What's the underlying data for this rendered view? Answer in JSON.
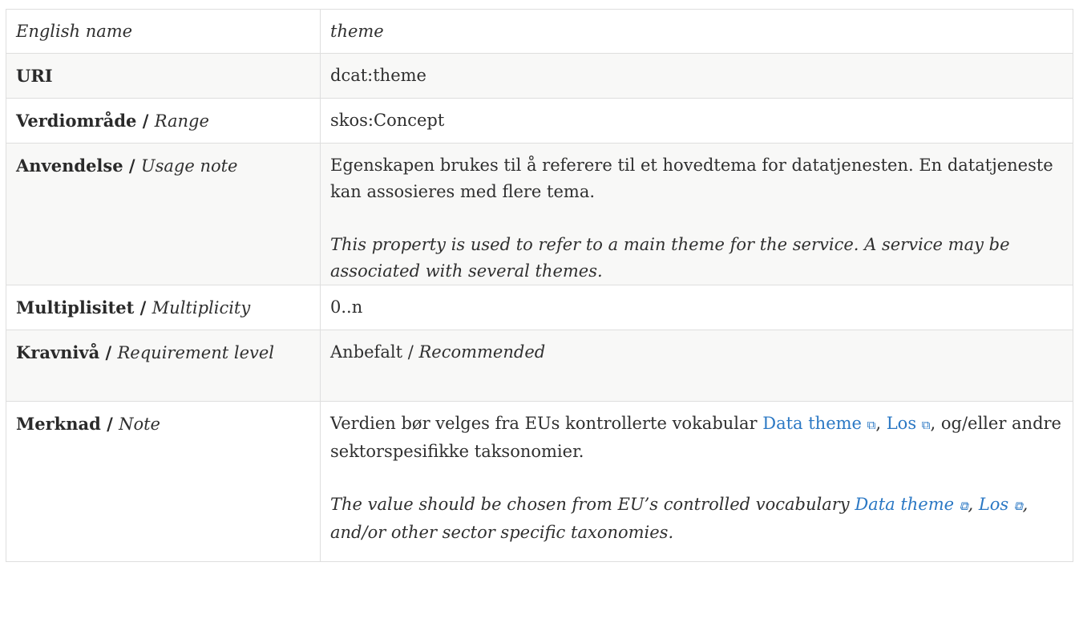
{
  "rows": {
    "english_name": {
      "label": "English name",
      "value": "theme"
    },
    "uri": {
      "label": "URI",
      "value": "dcat:theme"
    },
    "range": {
      "label_no": "Verdiområde",
      "sep": " / ",
      "label_en": "Range",
      "value": "skos:Concept"
    },
    "usage": {
      "label_no": "Anvendelse",
      "sep": " / ",
      "label_en": "Usage note",
      "value_no": "Egenskapen brukes til å referere til et hovedtema for datatjenesten. En datatjeneste kan assosieres med flere tema.",
      "value_en": "This property is used to refer to a main theme for the service. A service may be associated with several themes."
    },
    "multiplicity": {
      "label_no": "Multiplisitet",
      "sep": " / ",
      "label_en": "Multiplicity",
      "value": "0..n"
    },
    "requirement": {
      "label_no": "Kravnivå",
      "sep": " / ",
      "label_en": "Requirement level",
      "value_no": "Anbefalt",
      "value_sep": " / ",
      "value_en": "Recommended"
    },
    "note": {
      "label_no": "Merknad",
      "sep": " / ",
      "label_en": "Note",
      "no_text_before": "Verdien bør velges fra EUs kontrollerte vokabular ",
      "no_link_1": "Data theme",
      "no_sep_1": ", ",
      "no_link_2": "Los",
      "no_text_after": ", og/eller andre sektorspesifikke taksonomier.",
      "en_text_before": "The value should be chosen from EU’s controlled vocabulary ",
      "en_link_1": "Data theme",
      "en_sep_1": ", ",
      "en_link_2": "Los",
      "en_text_after": ", and/or other sector specific taxonomies."
    }
  },
  "icons": {
    "external_link": "external-link-icon",
    "glyph": "⧉"
  },
  "colors": {
    "link": "#2b78c4",
    "border": "#dedede",
    "stripe": "#f8f8f7",
    "text": "#2f2f2f"
  }
}
